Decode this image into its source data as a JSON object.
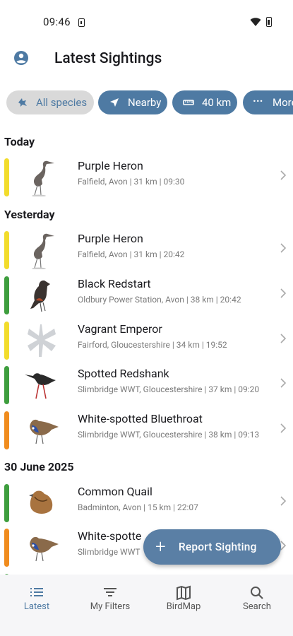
{
  "status": {
    "time": "09:46"
  },
  "header": {
    "title": "Latest Sightings"
  },
  "filters": {
    "chips": [
      {
        "label": "All species",
        "icon": "bird-icon",
        "active": false
      },
      {
        "label": "Nearby",
        "icon": "navigation-arrow-icon",
        "active": true
      },
      {
        "label": "40 km",
        "icon": "ruler-icon",
        "active": true
      },
      {
        "label": "More",
        "icon": "more-dots-icon",
        "active": true
      }
    ]
  },
  "sections": [
    {
      "title": "Today",
      "items": [
        {
          "name": "Purple Heron",
          "detail": "Falfield, Avon | 31 km | 09:30",
          "status_color": "#f2dc2c",
          "image": "heron"
        }
      ]
    },
    {
      "title": "Yesterday",
      "items": [
        {
          "name": "Purple Heron",
          "detail": "Falfield, Avon | 31 km | 20:42",
          "status_color": "#f2dc2c",
          "image": "heron"
        },
        {
          "name": "Black Redstart",
          "detail": "Oldbury Power Station, Avon | 38 km | 20:42",
          "status_color": "#3e9e3e",
          "image": "redstart"
        },
        {
          "name": "Vagrant Emperor",
          "detail": "Fairford, Gloucestershire | 34 km | 19:52",
          "status_color": "#f2dc2c",
          "image": "dragonfly"
        },
        {
          "name": "Spotted Redshank",
          "detail": "Slimbridge WWT, Gloucestershire | 37 km | 09:20",
          "status_color": "#3e9e3e",
          "image": "redshank"
        },
        {
          "name": "White-spotted Bluethroat",
          "detail": "Slimbridge WWT, Gloucestershire | 38 km | 09:13",
          "status_color": "#f08c1e",
          "image": "bluethroat"
        }
      ]
    },
    {
      "title": "30 June 2025",
      "items": [
        {
          "name": "Common Quail",
          "detail": "Badminton, Avon | 15 km | 22:07",
          "status_color": "#3e9e3e",
          "image": "quail"
        },
        {
          "name": "White-spotte",
          "detail": "Slimbridge WWT",
          "status_color": "#f08c1e",
          "image": "bluethroat"
        }
      ]
    }
  ],
  "fab": {
    "label": "Report Sighting"
  },
  "nav": [
    {
      "label": "Latest",
      "icon": "list-icon",
      "active": true
    },
    {
      "label": "My Filters",
      "icon": "filter-icon",
      "active": false
    },
    {
      "label": "BirdMap",
      "icon": "map-icon",
      "active": false
    },
    {
      "label": "Search",
      "icon": "search-icon",
      "active": false
    }
  ],
  "colors": {
    "accent": "#4e7aa3",
    "rare_yellow": "#f2dc2c",
    "green": "#3e9e3e",
    "orange": "#f08c1e"
  }
}
